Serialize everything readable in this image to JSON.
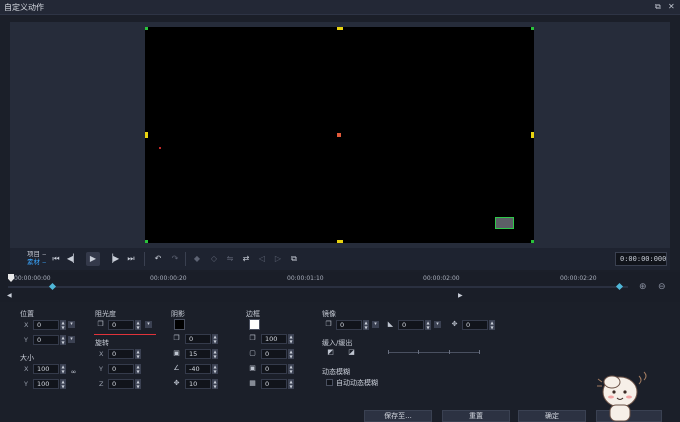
{
  "window": {
    "title": "自定义动作",
    "restore_icon": "restore-icon",
    "close_icon": "close-icon"
  },
  "mode": {
    "project": "项目",
    "clip": "素材"
  },
  "player": {
    "timecode": "0:00:00:000"
  },
  "timeline": {
    "ticks": [
      "00:00:00:00",
      "00:00:00:20",
      "00:00:01:10",
      "00:00:02:00",
      "00:00:02:20"
    ]
  },
  "props": {
    "position": {
      "label": "位置",
      "x_label": "X",
      "x": "0",
      "y_label": "Y",
      "y": "0"
    },
    "size": {
      "label": "大小",
      "x_label": "X",
      "x": "100",
      "y_label": "Y",
      "y": "100"
    },
    "opacity": {
      "label": "阻光度",
      "value": "0"
    },
    "rotation": {
      "label": "旋转",
      "x_label": "X",
      "x": "0",
      "y_label": "Y",
      "y": "0",
      "z_label": "Z",
      "z": "0"
    },
    "shadow": {
      "label": "阴影",
      "color": "#000000",
      "opacity": "0",
      "blur": "15",
      "angle": "-40",
      "distance": "10"
    },
    "border": {
      "label": "边框",
      "color": "#ffffff",
      "opacity": "100",
      "width": "0",
      "v2": "0",
      "v3": "0"
    },
    "mirror": {
      "label": "镜像",
      "v1": "0",
      "v2": "0",
      "v3": "0"
    },
    "ease": {
      "label": "缓入/缓出"
    },
    "motion_blur": {
      "label": "动态模糊",
      "auto_label": "自动动态模糊"
    }
  },
  "buttons": {
    "save_as": "保存至...",
    "reset": "重置",
    "ok": "确定"
  },
  "colors": {
    "accent": "#3aa6ff",
    "handle": "#29c23a",
    "midpoint": "#e9d30f"
  }
}
